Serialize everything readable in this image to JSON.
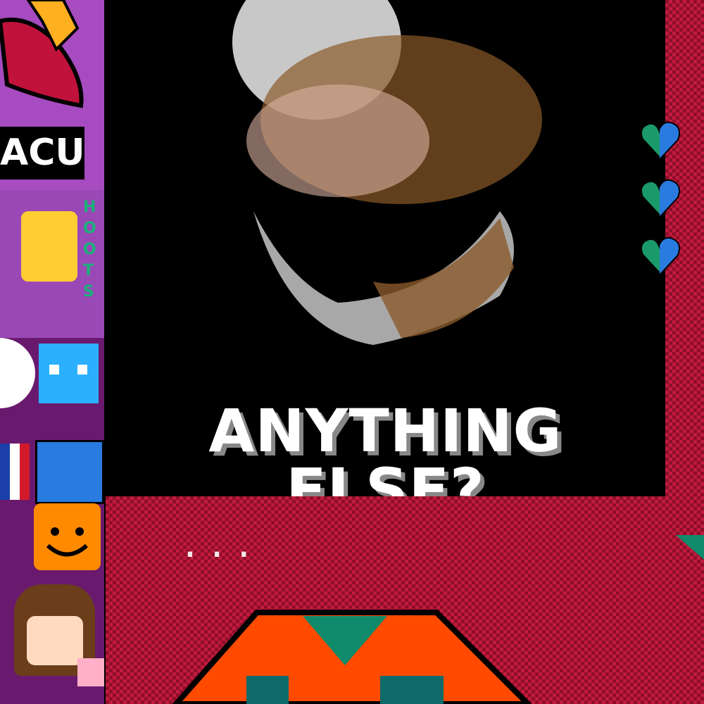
{
  "left_column": {
    "label_acu": "ACU",
    "vertical_text": "HOOTS"
  },
  "meme": {
    "caption": "ANYTHING ELSE?"
  },
  "red_area": {
    "dotted_text": "..."
  },
  "colors": {
    "background": "#000000",
    "red_dark": "#8e0f2a",
    "red_light": "#c21a3e",
    "orange": "#ff4a00",
    "teal": "#0f8a6a",
    "purple": "#a64bc0"
  },
  "icons": [
    "pixel-face-art",
    "chili-pepper-icon",
    "heart-icon",
    "smiley-icon",
    "anime-girl-avatar"
  ]
}
